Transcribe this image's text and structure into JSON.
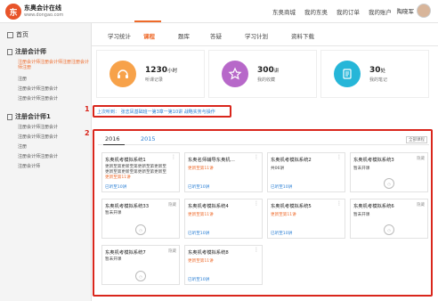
{
  "header": {
    "logo_mark": "东",
    "brand_name": "东奥会计在线",
    "brand_url": "www.dongao.com",
    "nav": [
      "东奥商城",
      "我的东奥",
      "我的订单",
      "我的账户"
    ],
    "user_name": "陶晓军"
  },
  "sidebar": {
    "home": "首页",
    "sections": [
      {
        "title": "注册会计师",
        "items": [
          "注册会计师注册会计师注册注册会计师注册",
          "注册",
          "注册会计师注册会计",
          "注册会计师注册会计"
        ]
      },
      {
        "title": "注册会计师1",
        "items": [
          "注册会计师注册会计",
          "注册会计师注册会计",
          "注册",
          "注册会计师注册会计",
          "注册会计师"
        ]
      }
    ]
  },
  "tabs": [
    "学习统计",
    "课程",
    "题库",
    "答疑",
    "学习计划",
    "资料下载"
  ],
  "stats": [
    {
      "value": "1230",
      "unit": "小时",
      "label": "听课记录",
      "color": "#f7a24a",
      "icon": "headphones-icon"
    },
    {
      "value": "300",
      "unit": "讲",
      "label": "我的收藏",
      "color": "#b768c9",
      "icon": "star-icon"
    },
    {
      "value": "30",
      "unit": "处",
      "label": "我的笔记",
      "color": "#26b6d8",
      "icon": "note-icon"
    }
  ],
  "recent": {
    "prefix": "上次听到：",
    "text": "张志凤基础班一第3章一第10讲",
    "action": "战略实务与操作"
  },
  "markers": [
    "1",
    "2"
  ],
  "years": [
    "2016",
    "2015"
  ],
  "all_courses": "全部课程",
  "cards": [
    {
      "title": "东奥机考模拟系统1",
      "lines": [
        "更新至第更新至第更新至第更新至",
        "更新至第更新至第更新至第更新至",
        "更新至第11讲"
      ],
      "link": "已听至10讲",
      "menu": "⋮"
    },
    {
      "title": "东奥名师辅导东奥机…",
      "lines": [
        "更新至第11讲"
      ],
      "link": "已听至10讲",
      "menu": "⋮"
    },
    {
      "title": "东奥机考模拟系统2",
      "lines": [
        "共06讲"
      ],
      "link": "已听至10讲",
      "menu": "⋮"
    },
    {
      "title": "东奥机考模拟系统3",
      "lines": [
        "暂未开课"
      ],
      "link": "",
      "menu": "隐藏"
    },
    {
      "title": "东奥机考模拟系统33",
      "lines": [
        "暂未开课"
      ],
      "link": "",
      "menu": "隐藏"
    },
    {
      "title": "东奥机考模拟系统4",
      "lines": [
        "更新至第11讲"
      ],
      "link": "已听至10讲",
      "menu": "⋮"
    },
    {
      "title": "东奥机考模拟系统5",
      "lines": [
        "更新至第11讲"
      ],
      "link": "已听至10讲",
      "menu": "⋮"
    },
    {
      "title": "东奥机考模拟系统6",
      "lines": [
        "暂未开课"
      ],
      "link": "",
      "menu": "隐藏"
    },
    {
      "title": "东奥机考模拟系统7",
      "lines": [
        "暂未开课"
      ],
      "link": "",
      "menu": "隐藏"
    },
    {
      "title": "东奥机考模拟系统8",
      "lines": [
        "更新至第11讲"
      ],
      "link": "已听至10讲",
      "menu": "⋮"
    }
  ]
}
